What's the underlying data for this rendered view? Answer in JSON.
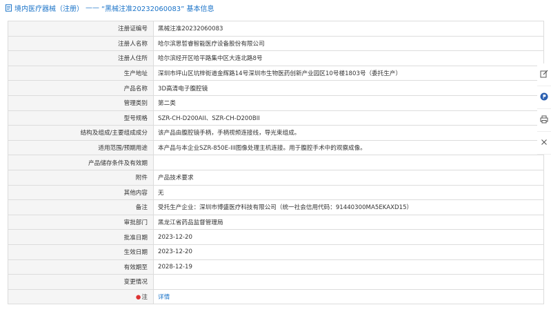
{
  "header": {
    "section": "境内医疗器械（注册）",
    "separator": "——",
    "title": "“黑械注准20232060083” 基本信息"
  },
  "rows": [
    {
      "label": "注册证编号",
      "value": "黑械注准20232060083"
    },
    {
      "label": "注册人名称",
      "value": "哈尔滨思哲睿智能医疗设备股份有限公司"
    },
    {
      "label": "注册人住所",
      "value": "哈尔滨经开区哈平路集中区大连北路8号"
    },
    {
      "label": "生产地址",
      "value": "深圳市坪山区坑梓街道金辉路14号深圳市生物医药创新产业园区10号楼1803号（委托生产）"
    },
    {
      "label": "产品名称",
      "value": "3D高清电子腹腔镜"
    },
    {
      "label": "管理类别",
      "value": "第二类"
    },
    {
      "label": "型号规格",
      "value": "SZR-CH-D200AII、SZR-CH-D200BII"
    },
    {
      "label": "结构及组成/主要组成成分",
      "value": "该产品由腹腔镜手柄，手柄视频连接线，导光束组成。"
    },
    {
      "label": "适用范围/预期用途",
      "value": "本产品与本企业SZR-850E-III图像处理主机连接。用于腹腔手术中的观察成像。"
    },
    {
      "label": "产品储存条件及有效期",
      "value": ""
    },
    {
      "label": "附件",
      "value": "产品技术要求"
    },
    {
      "label": "其他内容",
      "value": "无"
    },
    {
      "label": "备注",
      "value": "受托生产企业：深圳市博盛医疗科技有限公司（统一社会信用代码：91440300MA5EKAXD15）"
    },
    {
      "label": "审批部门",
      "value": "黑龙江省药品监督管理局"
    },
    {
      "label": "批准日期",
      "value": "2023-12-20"
    },
    {
      "label": "生效日期",
      "value": "2023-12-20"
    },
    {
      "label": "有效期至",
      "value": "2028-12-19"
    },
    {
      "label": "变更情况",
      "value": ""
    }
  ],
  "note_row": {
    "star": "●",
    "label": "注",
    "link": "详情"
  },
  "side_tools": [
    "edit-icon",
    "p-badge-icon",
    "print-icon",
    "close-icon"
  ]
}
